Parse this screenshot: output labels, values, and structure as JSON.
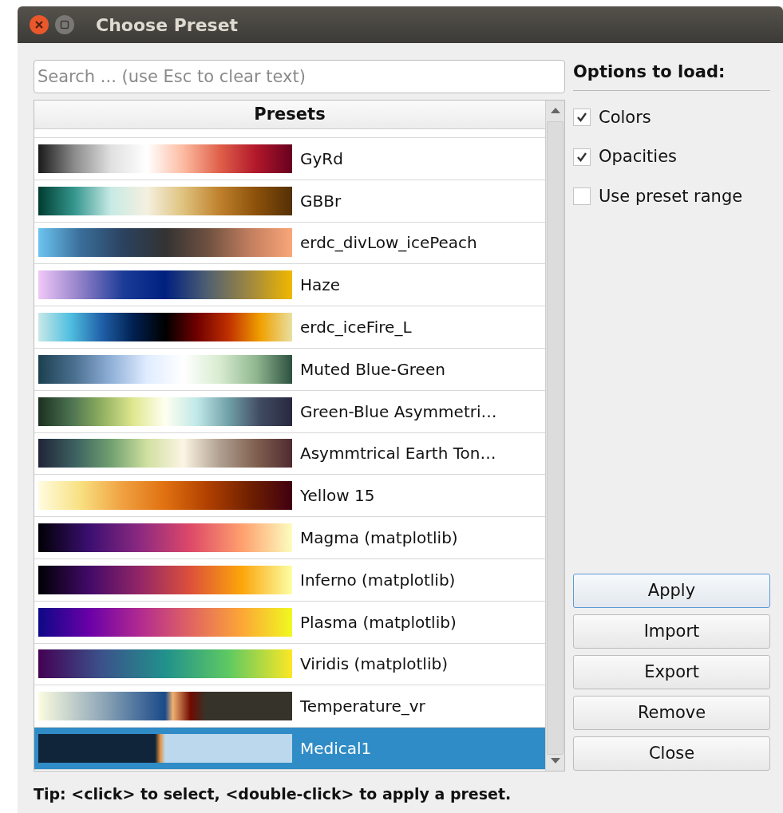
{
  "window": {
    "title": "Choose Preset"
  },
  "search": {
    "placeholder": "Search ... (use Esc to clear text)"
  },
  "table": {
    "header": "Presets",
    "rows": [
      {
        "name": "GyRd",
        "selected": false
      },
      {
        "name": "GBBr",
        "selected": false
      },
      {
        "name": "erdc_divLow_icePeach",
        "selected": false
      },
      {
        "name": "Haze",
        "selected": false
      },
      {
        "name": "erdc_iceFire_L",
        "selected": false
      },
      {
        "name": "Muted Blue-Green",
        "selected": false
      },
      {
        "name": "Green-Blue Asymmetri…",
        "selected": false
      },
      {
        "name": "Asymmtrical Earth Ton…",
        "selected": false
      },
      {
        "name": "Yellow 15",
        "selected": false
      },
      {
        "name": "Magma (matplotlib)",
        "selected": false
      },
      {
        "name": "Inferno (matplotlib)",
        "selected": false
      },
      {
        "name": "Plasma (matplotlib)",
        "selected": false
      },
      {
        "name": "Viridis (matplotlib)",
        "selected": false
      },
      {
        "name": "Temperature_vr",
        "selected": false
      },
      {
        "name": "Medical1",
        "selected": true
      }
    ]
  },
  "options": {
    "title": "Options to load:",
    "checkboxes": [
      {
        "label": "Colors",
        "checked": true
      },
      {
        "label": "Opacities",
        "checked": true
      },
      {
        "label": "Use preset range",
        "checked": false
      }
    ]
  },
  "buttons": [
    {
      "label": "Apply",
      "default": true
    },
    {
      "label": "Import",
      "default": false
    },
    {
      "label": "Export",
      "default": false
    },
    {
      "label": "Remove",
      "default": false
    },
    {
      "label": "Close",
      "default": false
    }
  ],
  "tip": "Tip: <click> to select, <double-click> to apply a preset."
}
